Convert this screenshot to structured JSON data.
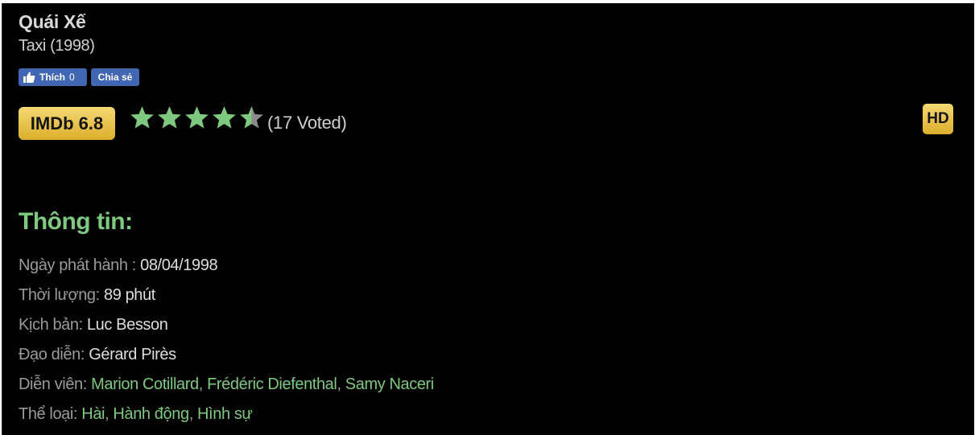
{
  "movie": {
    "title": "Quái Xế",
    "subtitle": "Taxi (1998)"
  },
  "social": {
    "like_label": "Thích",
    "like_count": "0",
    "share_label": "Chia sẻ"
  },
  "rating": {
    "imdb_label": "IMDb 6.8",
    "stars": 4.5,
    "star_max": 5,
    "votes_text": "(17 Voted)",
    "quality_badge": "HD"
  },
  "colors": {
    "star_filled": "#7ec880",
    "star_empty": "#8a8a8a",
    "accent_green": "#7ec880",
    "badge_gold": "#e9c44a",
    "facebook_blue": "#4267b2"
  },
  "info": {
    "heading": "Thông tin:",
    "release_label": "Ngày phát hành : ",
    "release_value": "08/04/1998",
    "runtime_label": "Thời lượng: ",
    "runtime_value": "89 phút",
    "writer_label": "Kịch bản: ",
    "writer_value": "Luc Besson",
    "director_label": "Đạo diễn: ",
    "director_value": "Gérard Pirès",
    "cast_label": "Diễn viên: ",
    "cast": [
      "Marion Cotillard",
      "Frédéric Diefenthal",
      "Samy Naceri"
    ],
    "genre_label": "Thể loại: ",
    "genres": [
      "Hài",
      "Hành động",
      "Hình sự"
    ],
    "separator": ", "
  }
}
